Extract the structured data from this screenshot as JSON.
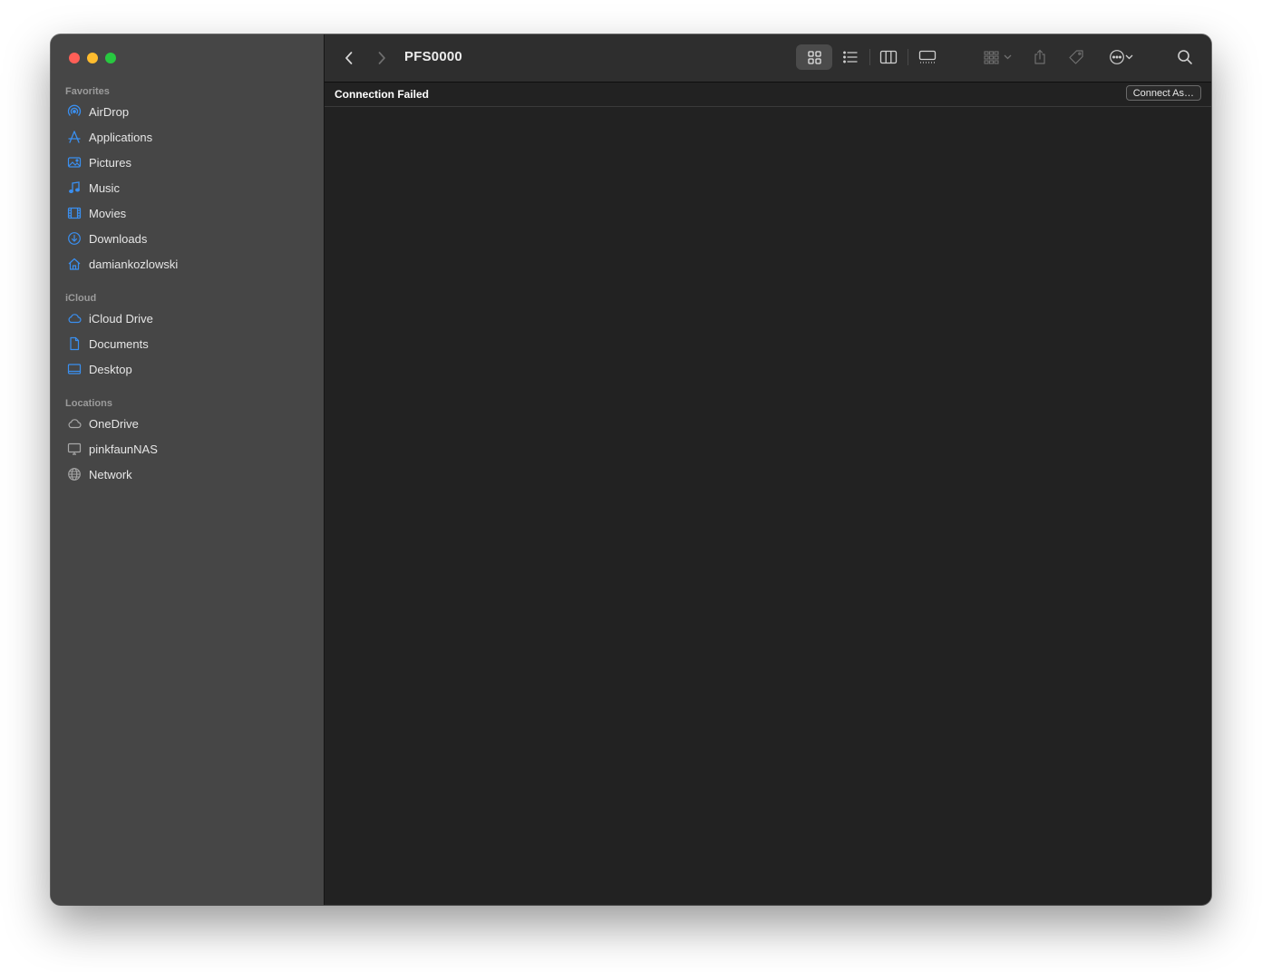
{
  "window": {
    "title": "PFS0000"
  },
  "sidebar": {
    "favorites_title": "Favorites",
    "favorites": [
      {
        "label": "AirDrop",
        "icon": "airdrop-icon"
      },
      {
        "label": "Applications",
        "icon": "applications-icon"
      },
      {
        "label": "Pictures",
        "icon": "pictures-icon"
      },
      {
        "label": "Music",
        "icon": "music-icon"
      },
      {
        "label": "Movies",
        "icon": "movies-icon"
      },
      {
        "label": "Downloads",
        "icon": "downloads-icon"
      },
      {
        "label": "damiankozlowski",
        "icon": "home-icon"
      }
    ],
    "icloud_title": "iCloud",
    "icloud": [
      {
        "label": "iCloud Drive",
        "icon": "icloud-icon"
      },
      {
        "label": "Documents",
        "icon": "document-icon"
      },
      {
        "label": "Desktop",
        "icon": "desktop-icon"
      }
    ],
    "locations_title": "Locations",
    "locations": [
      {
        "label": "OneDrive",
        "icon": "cloud-icon"
      },
      {
        "label": "pinkfaunNAS",
        "icon": "display-icon"
      },
      {
        "label": "Network",
        "icon": "globe-icon"
      }
    ]
  },
  "banner": {
    "message": "Connection Failed",
    "button_label": "Connect As…"
  },
  "colors": {
    "accent": "#3a8ff0",
    "sidebar_bg": "#464646",
    "content_bg": "#222222",
    "toolbar_bg": "#2e2e2e"
  }
}
